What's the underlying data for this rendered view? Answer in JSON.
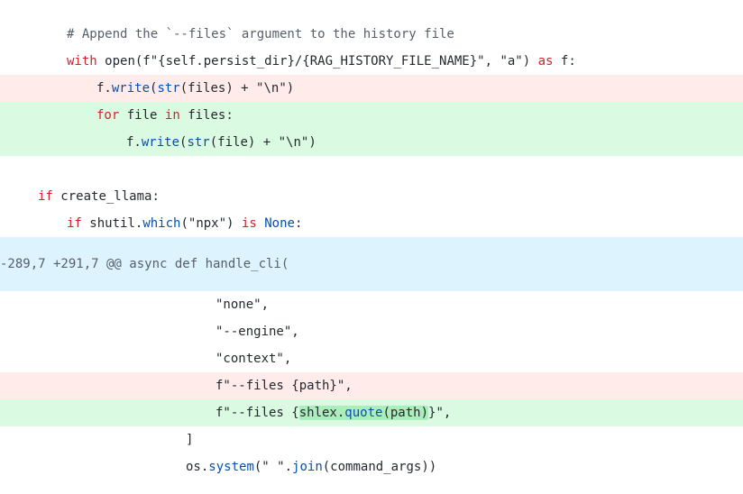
{
  "diff": {
    "lines": {
      "comment": "# Append the `--files` argument to the history file",
      "with_kw": "with",
      "with_open": "open",
      "with_fstring": "(f\"{self.persist_dir}/{RAG_HISTORY_FILE_NAME}\", \"a\")",
      "with_as": "as",
      "with_target": "f:",
      "del_write_obj": "f.",
      "del_write_fn": "write",
      "del_str_fn": "str",
      "del_args": "(files) + \"\\n\")",
      "add_for_kw": "for",
      "add_for_var": "file",
      "add_in_kw": "in",
      "add_for_iter": "files:",
      "add_write_obj": "f.",
      "add_write_fn": "write",
      "add_str_fn": "str",
      "add_args": "(file) + \"\\n\")",
      "if_kw": "if",
      "if_cond": "create_llama:",
      "if2_kw": "if",
      "if2_obj": "shutil.",
      "if2_fn": "which",
      "if2_args": "(\"npx\")",
      "if2_is": "is",
      "if2_none": "None",
      "if2_colon": ":"
    },
    "hunk_header": "-289,7 +291,7 @@ async def handle_cli(",
    "lines2": {
      "none": "\"none\",",
      "engine": "\"--engine\",",
      "context": "\"context\",",
      "del_files": "f\"--files {path}\",",
      "add_files_pre": "f\"--files {",
      "add_files_obj": "shlex.",
      "add_files_fn": "quote",
      "add_files_arg": "(path)",
      "add_files_post": "}\",",
      "close_bracket": "]",
      "sys_obj": "os.",
      "sys_fn": "system",
      "sys_str": "(\" \".",
      "sys_join": "join",
      "sys_args": "(command_args))"
    }
  },
  "colors": {
    "deleted_bg": "#ffebe9",
    "added_bg": "#dafbe1",
    "hunk_bg": "#ddf4ff",
    "keyword": "#cf222e",
    "function": "#0550ae",
    "comment": "#57606a"
  }
}
